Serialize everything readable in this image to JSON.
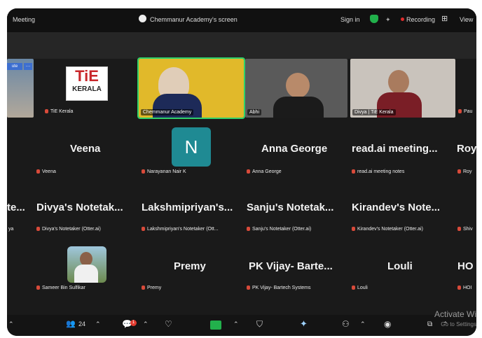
{
  "topbar": {
    "meeting_label": "Meeting",
    "share_title": "Chemmanur Academy's screen",
    "sign_in": "Sign in",
    "recording": "Recording",
    "view": "View",
    "view_grid_icon": "grid-icon"
  },
  "strip": {
    "cute_label": "ute",
    "more_label": "…"
  },
  "tiles": {
    "tie_kerala": {
      "label": "TiE Kerala",
      "logo_text": "TiE",
      "logo_sub": "KERALA"
    },
    "chemmanur": {
      "label": "Chemmanur Academy"
    },
    "abhi": {
      "label": "Abhi"
    },
    "divya": {
      "label": "Divya | TiE Kerala"
    },
    "pau": {
      "label": "Pau"
    }
  },
  "row2": [
    {
      "big": "Veena",
      "small": "Veena"
    },
    {
      "big": "N",
      "small": "Narayanan Nair K"
    },
    {
      "big": "Anna George",
      "small": "Anna George"
    },
    {
      "big": "read.ai meeting...",
      "small": "read.ai meeting notes"
    },
    {
      "big": "Roy",
      "small": "Roy"
    }
  ],
  "row3": [
    {
      "big": "te...",
      "small": "ya"
    },
    {
      "big": "Divya's Notetak...",
      "small": "Divya's Notetaker (Otter.ai)"
    },
    {
      "big": "Lakshmipriyan's...",
      "small": "Lakshmipriyan's Notetaker (Ott..."
    },
    {
      "big": "Sanju's Notetak...",
      "small": "Sanju's Notetaker (Otter.ai)"
    },
    {
      "big": "Kirandev's Note...",
      "small": "Kirandev's Notetaker (Otter.ai)"
    },
    {
      "big": "",
      "small": "Shiv"
    }
  ],
  "row4": [
    {
      "big": "",
      "small": "Sameer Bin Sulfikar"
    },
    {
      "big": "Premy",
      "small": "Premy"
    },
    {
      "big": "PK Vijay- Barte...",
      "small": "PK Vijay- Bartech Systems"
    },
    {
      "big": "Louli",
      "small": "Louli"
    },
    {
      "big": "HO",
      "small": "HOI"
    }
  ],
  "bottombar": {
    "participants_count": "24",
    "chat_badge": "1"
  },
  "watermark": {
    "line1": "Activate Wi",
    "line2": "Go to Settings"
  },
  "colors": {
    "active_speaker": "#2fd16a",
    "avatar_teal": "#1f8a93",
    "rec_red": "#e02b2b"
  }
}
